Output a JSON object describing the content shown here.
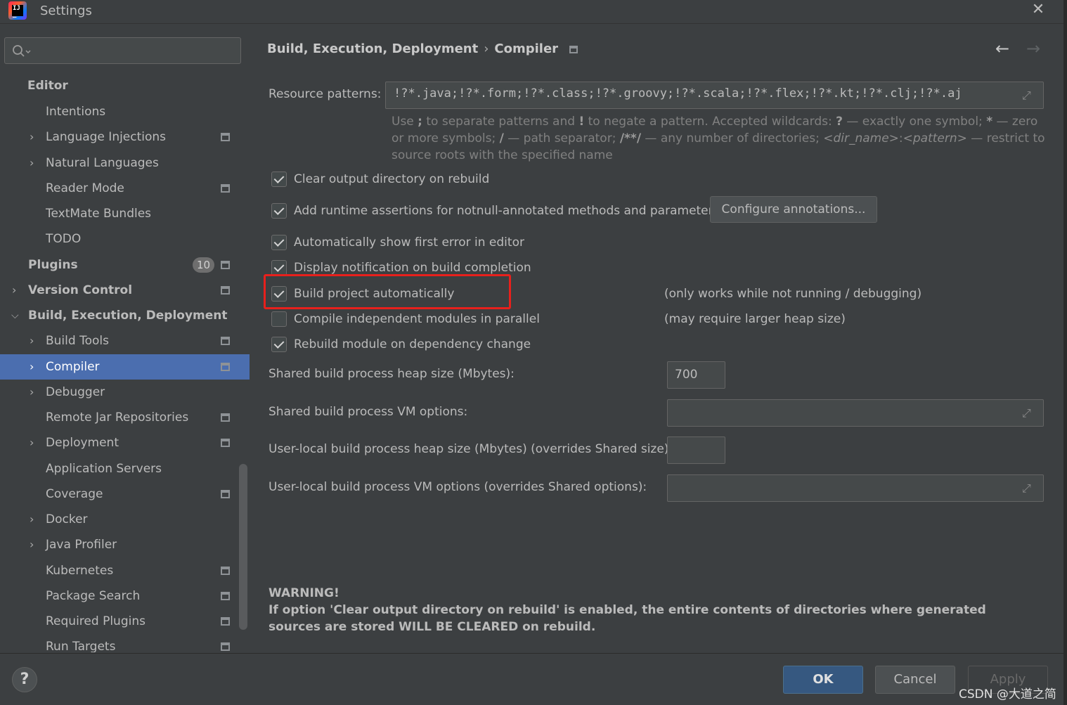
{
  "window": {
    "title": "Settings",
    "close_icon": "close-icon"
  },
  "sidebar": {
    "search_placeholder": "",
    "items": [
      {
        "label": "Editor"
      },
      {
        "label": "Intentions"
      },
      {
        "label": "Language Injections"
      },
      {
        "label": "Natural Languages"
      },
      {
        "label": "Reader Mode"
      },
      {
        "label": "TextMate Bundles"
      },
      {
        "label": "TODO"
      },
      {
        "label": "Plugins",
        "badge": "10"
      },
      {
        "label": "Version Control"
      },
      {
        "label": "Build, Execution, Deployment"
      },
      {
        "label": "Build Tools"
      },
      {
        "label": "Compiler"
      },
      {
        "label": "Debugger"
      },
      {
        "label": "Remote Jar Repositories"
      },
      {
        "label": "Deployment"
      },
      {
        "label": "Application Servers"
      },
      {
        "label": "Coverage"
      },
      {
        "label": "Docker"
      },
      {
        "label": "Java Profiler"
      },
      {
        "label": "Kubernetes"
      },
      {
        "label": "Package Search"
      },
      {
        "label": "Required Plugins"
      },
      {
        "label": "Run Targets"
      }
    ],
    "selected": "Compiler"
  },
  "breadcrumb": {
    "parent": "Build, Execution, Deployment",
    "separator": "›",
    "current": "Compiler"
  },
  "nav": {
    "back": "←",
    "forward": "→"
  },
  "resource_patterns": {
    "label": "Resource patterns:",
    "value": "!?*.java;!?*.form;!?*.class;!?*.groovy;!?*.scala;!?*.flex;!?*.kt;!?*.clj;!?*.aj",
    "hint": {
      "part1": "Use ",
      "semi": ";",
      "part2": " to separate patterns and ",
      "bang": "!",
      "part3": " to negate a pattern. Accepted wildcards: ",
      "q": "?",
      "part4": " — exactly one symbol; ",
      "star": "*",
      "part5": " — zero or more symbols; ",
      "slash": "/",
      "part6": " — path separator; ",
      "dstar": "/**/",
      "part7": " — any number of directories; ",
      "dir": "<dir_name>",
      "colon": ":",
      "pat": "<pattern>",
      "part8": " — restrict to source roots with the specified name"
    }
  },
  "options": [
    {
      "label": "Clear output directory on rebuild",
      "checked": true
    },
    {
      "label": "Add runtime assertions for notnull-annotated methods and parameters",
      "checked": true
    },
    {
      "label": "Automatically show first error in editor",
      "checked": true
    },
    {
      "label": "Display notification on build completion",
      "checked": true
    },
    {
      "label": "Build project automatically",
      "checked": true,
      "note": "(only works while not running / debugging)"
    },
    {
      "label": "Compile independent modules in parallel",
      "checked": false,
      "note": "(may require larger heap size)"
    },
    {
      "label": "Rebuild module on dependency change",
      "checked": true
    }
  ],
  "configure_button": "Configure annotations...",
  "heap": {
    "shared_heap_label": "Shared build process heap size (Mbytes):",
    "shared_heap_value": "700",
    "shared_vm_label": "Shared build process VM options:",
    "shared_vm_value": "",
    "local_heap_label": "User-local build process heap size (Mbytes) (overrides Shared size):",
    "local_heap_value": "",
    "local_vm_label": "User-local build process VM options (overrides Shared options):",
    "local_vm_value": ""
  },
  "warning": {
    "title": "WARNING!",
    "body": "If option 'Clear output directory on rebuild' is enabled, the entire contents of directories where generated sources are stored WILL BE CLEARED on rebuild."
  },
  "footer": {
    "help": "?",
    "ok": "OK",
    "cancel": "Cancel",
    "apply": "Apply"
  },
  "watermark": "CSDN @大道之简",
  "colors": {
    "background": "#3c3f41",
    "selection": "#4b6eaf",
    "highlight_box": "#e8201c",
    "ok_button": "#365880"
  }
}
